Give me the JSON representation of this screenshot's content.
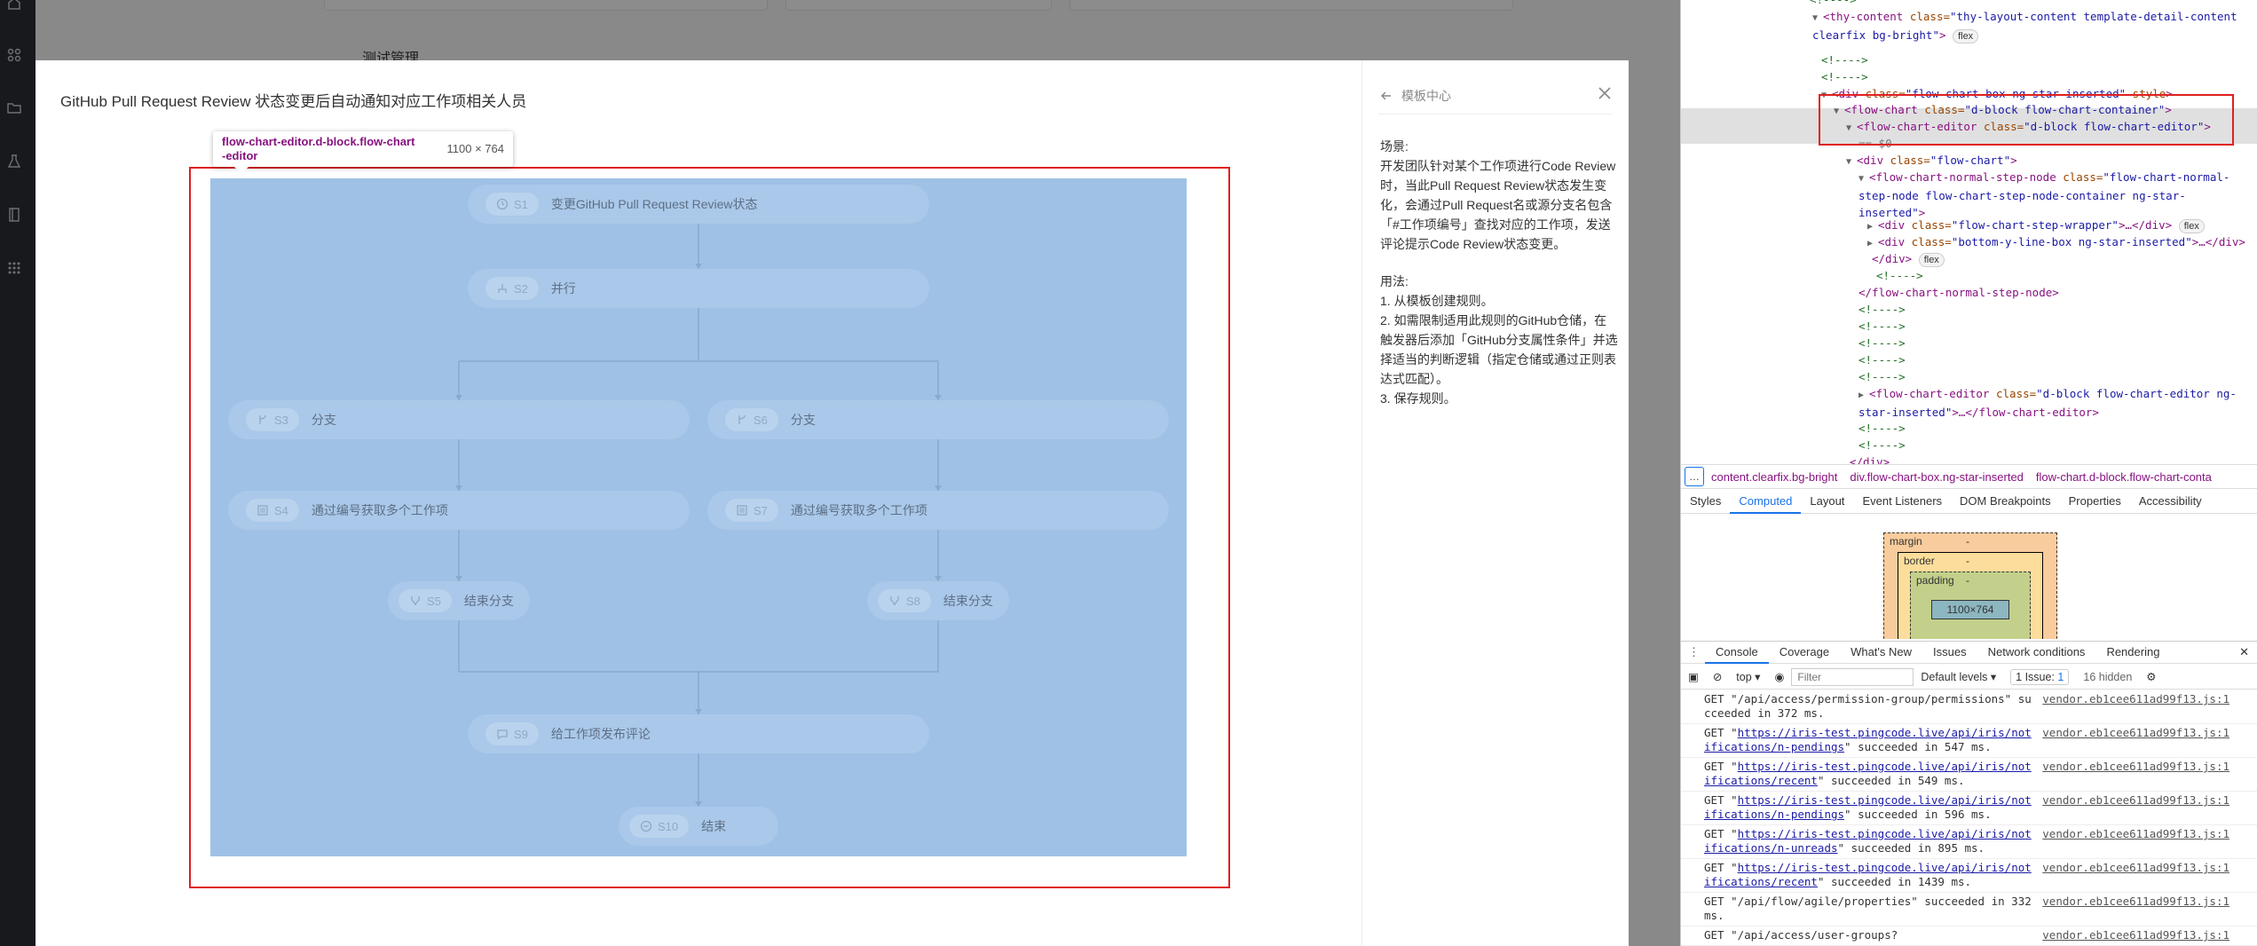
{
  "background": {
    "heading": "测试管理"
  },
  "modal": {
    "title": "GitHub Pull Request Review 状态变更后自动通知对应工作项相关人员",
    "hover_tooltip": {
      "selector": "flow-chart-editor.d-block.flow-chart-editor",
      "size": "1100 × 764"
    },
    "nodes": [
      {
        "step": "S1",
        "label": "变更GitHub Pull Request Review状态",
        "icon": "clock-icon"
      },
      {
        "step": "S2",
        "label": "并行",
        "icon": "parallel-icon"
      },
      {
        "step": "S3",
        "label": "分支",
        "icon": "branch-icon"
      },
      {
        "step": "S6",
        "label": "分支",
        "icon": "branch-icon"
      },
      {
        "step": "S4",
        "label": "通过编号获取多个工作项",
        "icon": "list-icon"
      },
      {
        "step": "S7",
        "label": "通过编号获取多个工作项",
        "icon": "list-icon"
      },
      {
        "step": "S5",
        "label": "结束分支",
        "icon": "merge-icon"
      },
      {
        "step": "S8",
        "label": "结束分支",
        "icon": "merge-icon"
      },
      {
        "step": "S9",
        "label": "给工作项发布评论",
        "icon": "comment-icon"
      },
      {
        "step": "S10",
        "label": "结束",
        "icon": "stop-icon"
      }
    ],
    "side": {
      "back_label": "模板中心",
      "scene_title": "场景:",
      "scene_text": "开发团队针对某个工作项进行Code Review时，当此Pull Request Review状态发生变化，会通过Pull Request名或源分支名包含「#工作项编号」查找对应的工作项，发送评论提示Code Review状态变更。",
      "usage_title": "用法:",
      "usage_steps": [
        "1. 从模板创建规则。",
        "2. 如需限制适用此规则的GitHub仓储，在触发器后添加「GitHub分支属性条件」并选择适当的判断逻辑（指定仓储或通过正则表达式匹配）。",
        "3. 保存规则。"
      ]
    }
  },
  "devtools": {
    "dom_lines": [
      {
        "kind": "comment",
        "text": "<!---->"
      },
      {
        "kind": "open",
        "tag": "thy-content",
        "attrs": "class=\"thy-layout-content template-detail-content clearfix bg-bright\"",
        "badge": "flex"
      },
      {
        "kind": "comment",
        "text": "<!---->"
      },
      {
        "kind": "comment",
        "text": "<!---->"
      },
      {
        "kind": "open",
        "tag": "div",
        "attrs": "class=\"flow-chart-box ng-star-inserted\" style"
      },
      {
        "kind": "open",
        "tag": "flow-chart",
        "attrs": "class=\"d-block flow-chart-container\""
      },
      {
        "kind": "open",
        "tag": "flow-chart-editor",
        "attrs": "class=\"d-block flow-chart-editor\""
      },
      {
        "kind": "eq",
        "text": "== $0"
      },
      {
        "kind": "open",
        "tag": "div",
        "attrs": "class=\"flow-chart\""
      },
      {
        "kind": "open",
        "tag": "flow-chart-normal-step-node",
        "attrs": "class=\"flow-chart-normal-step-node flow-chart-step-node-container ng-star-inserted\""
      },
      {
        "kind": "collapsed",
        "tag": "div",
        "attrs": "class=\"flow-chart-step-wrapper\"",
        "badge": "flex"
      },
      {
        "kind": "collapsed",
        "tag": "div",
        "attrs": "class=\"bottom-y-line-box ng-star-inserted\""
      },
      {
        "kind": "close",
        "text": "</div>",
        "badge": "flex"
      },
      {
        "kind": "comment",
        "text": "<!---->"
      },
      {
        "kind": "close",
        "text": "</flow-chart-normal-step-node>"
      },
      {
        "kind": "comment",
        "text": "<!---->"
      },
      {
        "kind": "comment",
        "text": "<!---->"
      },
      {
        "kind": "comment",
        "text": "<!---->"
      },
      {
        "kind": "comment",
        "text": "<!---->"
      },
      {
        "kind": "comment",
        "text": "<!---->"
      },
      {
        "kind": "collapsed",
        "tag": "flow-chart-editor",
        "attrs": "class=\"d-block flow-chart-editor ng-star-inserted\""
      },
      {
        "kind": "comment",
        "text": "<!---->"
      },
      {
        "kind": "comment",
        "text": "<!---->"
      },
      {
        "kind": "close",
        "text": "</div>"
      }
    ],
    "breadcrumbs": [
      "content.clearfix.bg-bright",
      "div.flow-chart-box.ng-star-inserted",
      "flow-chart.d-block.flow-chart-conta"
    ],
    "panel_tabs": [
      "Styles",
      "Computed",
      "Layout",
      "Event Listeners",
      "DOM Breakpoints",
      "Properties",
      "Accessibility"
    ],
    "active_panel_tab": "Computed",
    "box_model": {
      "margin": "margin",
      "border": "border",
      "padding": "padding",
      "content": "1100×764",
      "dash": "-"
    },
    "drawer_tabs": [
      "Console",
      "Coverage",
      "What's New",
      "Issues",
      "Network conditions",
      "Rendering"
    ],
    "active_drawer_tab": "Console",
    "console_toolbar": {
      "context": "top",
      "filter_placeholder": "Filter",
      "levels": "Default levels",
      "issues": "1 Issue:",
      "issues_count": "1",
      "hidden": "16 hidden"
    },
    "logs": [
      {
        "pre": "GET \"/api/access/permission-group/permissions\" succeeded in 372 ms.",
        "link": "",
        "post": "",
        "src": "vendor.eb1cee611ad99f13.js:1"
      },
      {
        "pre": "GET \"",
        "link": "https://iris-test.pingcode.live/api/iris/notifications/n-pendings",
        "post": "\" succeeded in 547 ms.",
        "src": "vendor.eb1cee611ad99f13.js:1"
      },
      {
        "pre": "GET \"",
        "link": "https://iris-test.pingcode.live/api/iris/notifications/recent",
        "post": "\" succeeded in 549 ms.",
        "src": "vendor.eb1cee611ad99f13.js:1"
      },
      {
        "pre": "GET \"",
        "link": "https://iris-test.pingcode.live/api/iris/notifications/n-pendings",
        "post": "\" succeeded in 596 ms.",
        "src": "vendor.eb1cee611ad99f13.js:1"
      },
      {
        "pre": "GET \"",
        "link": "https://iris-test.pingcode.live/api/iris/notifications/n-unreads",
        "post": "\" succeeded in 895 ms.",
        "src": "vendor.eb1cee611ad99f13.js:1"
      },
      {
        "pre": "GET \"",
        "link": "https://iris-test.pingcode.live/api/iris/notifications/recent",
        "post": "\" succeeded in 1439 ms.",
        "src": "vendor.eb1cee611ad99f13.js:1"
      },
      {
        "pre": "GET \"/api/flow/agile/properties\" succeeded in 332 ms.",
        "link": "",
        "post": "",
        "src": "vendor.eb1cee611ad99f13.js:1"
      },
      {
        "pre": "GET \"/api/access/user-groups?",
        "link": "",
        "post": "",
        "src": "vendor.eb1cee611ad99f13.js:1"
      }
    ]
  }
}
